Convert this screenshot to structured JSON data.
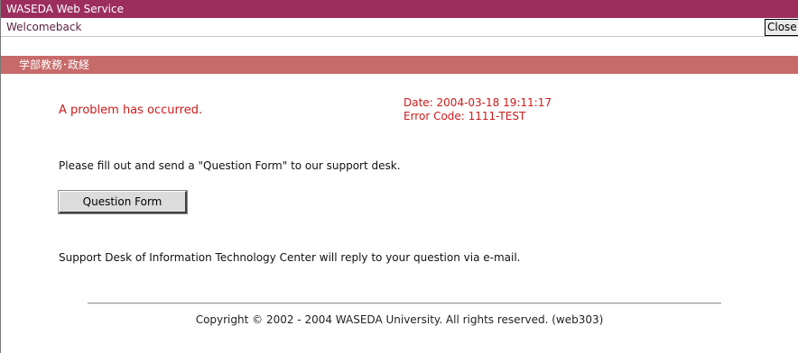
{
  "window": {
    "title": "WASEDA Web Service"
  },
  "welcome": {
    "text": "Welcomeback",
    "close_label": "Close"
  },
  "section": {
    "title": "学部教務･政経"
  },
  "error": {
    "message": "A problem has occurred.",
    "date_line": "Date: 2004-03-18 19:11:17",
    "code_line": "Error Code: 1111-TEST"
  },
  "body": {
    "instruction": "Please fill out and send a \"Question Form\" to our support desk.",
    "question_form_label": "Question Form",
    "reply_note": "Support Desk of Information Technology Center will reply to your question via e-mail."
  },
  "footer": {
    "copyright": "Copyright ©  2002 - 2004 WASEDA University. All rights reserved. (web303)"
  },
  "colors": {
    "titlebar": "#9c2e5e",
    "sectionbar": "#c76a6a",
    "error_text": "#cc1a1a"
  }
}
